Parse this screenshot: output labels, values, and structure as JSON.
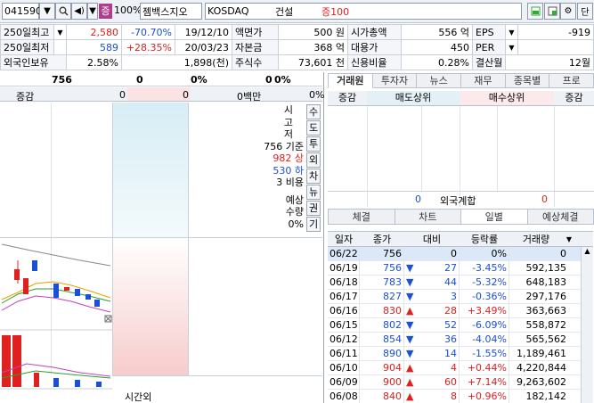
{
  "toolbar": {
    "code": "041590",
    "pct": "100%",
    "badge": "증",
    "name": "젬백스지오",
    "market": "KOSDAQ",
    "sector": "건설",
    "margin": "증100",
    "right_btn": "단"
  },
  "info": {
    "r1": [
      "250일최고",
      "2,580",
      "-70.70%",
      "19/12/10",
      "액면가",
      "500 원",
      "시가총액",
      "556 억",
      "EPS",
      "-919"
    ],
    "r2": [
      "250일최저",
      "589",
      "+28.35%",
      "20/03/23",
      "자본금",
      "368 억",
      "대용가",
      "450",
      "PER",
      ""
    ],
    "r3": [
      "외국인보유",
      "2.58%",
      "1,898(천)",
      "주식수",
      "73,601 천",
      "신용비율",
      "0.28%",
      "결산월",
      "12월"
    ]
  },
  "orderbook": {
    "top": [
      "756",
      "0",
      "0%",
      "0",
      "0%"
    ],
    "hdr": [
      "증감",
      "0",
      "0",
      "0백만",
      "0%"
    ],
    "mid_labels": [
      "시",
      "고",
      "저"
    ],
    "base": "756 기준",
    "upper": "982 상",
    "lower": "530 하",
    "cost": "3 비용",
    "expected": "예상",
    "qty": "수량",
    "pct": "0%",
    "side_tabs": [
      "수",
      "도",
      "투",
      "외",
      "차",
      "뉴",
      "권",
      "기"
    ],
    "bottom": "시간외"
  },
  "broker": {
    "tabs": [
      "거래원",
      "투자자",
      "뉴스",
      "재무",
      "종목별",
      "프로"
    ],
    "headers": [
      "증감",
      "매도상위",
      "매수상위",
      "증감"
    ],
    "foreign": [
      "0",
      "외국계합",
      "0"
    ]
  },
  "daily": {
    "tabs": [
      "체결",
      "차트",
      "일별",
      "예상체결"
    ],
    "headers": [
      "일자",
      "종가",
      "대비",
      "등락률",
      "거래량"
    ],
    "rows": [
      [
        "06/22",
        "756",
        "",
        "0",
        "0%",
        "0"
      ],
      [
        "06/19",
        "756",
        "down",
        "27",
        "-3.45%",
        "592,135"
      ],
      [
        "06/18",
        "783",
        "down",
        "44",
        "-5.32%",
        "648,183"
      ],
      [
        "06/17",
        "827",
        "down",
        "3",
        "-0.36%",
        "297,176"
      ],
      [
        "06/16",
        "830",
        "up",
        "28",
        "+3.49%",
        "363,663"
      ],
      [
        "06/15",
        "802",
        "down",
        "52",
        "-6.09%",
        "558,872"
      ],
      [
        "06/12",
        "854",
        "down",
        "36",
        "-4.04%",
        "565,562"
      ],
      [
        "06/11",
        "890",
        "down",
        "14",
        "-1.55%",
        "1,189,461"
      ],
      [
        "06/10",
        "904",
        "up",
        "4",
        "+0.44%",
        "4,220,844"
      ],
      [
        "06/09",
        "900",
        "up",
        "60",
        "+7.14%",
        "9,263,602"
      ],
      [
        "06/08",
        "840",
        "up",
        "8",
        "+0.96%",
        "182,142"
      ]
    ]
  }
}
